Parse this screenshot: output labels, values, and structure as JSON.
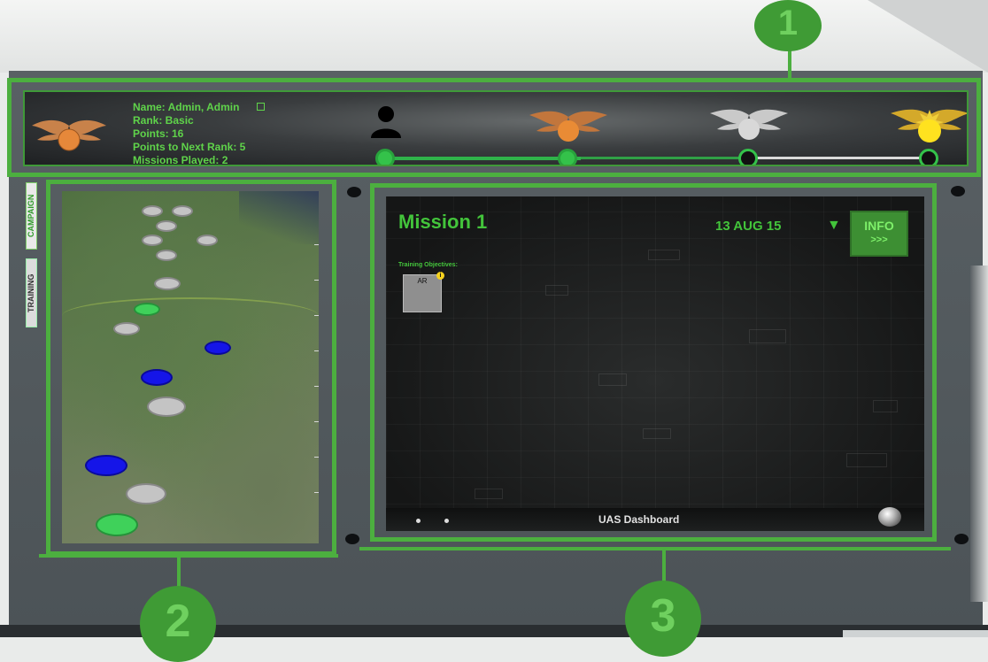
{
  "header": {
    "player": {
      "name": "Name: Admin, Admin",
      "rank": "Rank: Basic",
      "points": "Points: 16",
      "points_next": "Points to Next Rank: 5",
      "missions": "Missions Played: 2"
    },
    "rank_progress": {
      "stages_completed": 2,
      "stages_total": 4
    }
  },
  "side_tabs": {
    "campaign": "CAMPAIGN",
    "training": "TRAINING"
  },
  "mission": {
    "title": "Mission 1",
    "date": "13 AUG 15",
    "dropdown_glyph": "▼",
    "info_label": "INFO",
    "info_arrows": ">>>",
    "training_objectives_label": "Training Objectives:",
    "objective_tile_label": "AR",
    "objective_info_glyph": "i",
    "footer_label": "UAS Dashboard"
  },
  "callouts": {
    "one": "1",
    "two": "2",
    "three": "3"
  },
  "colors": {
    "accent_green": "#4caf3f",
    "text_green": "#43c43b",
    "marker_blue": "#1515e8",
    "marker_grey": "#c4c4c4",
    "marker_green": "#3fd15a"
  }
}
